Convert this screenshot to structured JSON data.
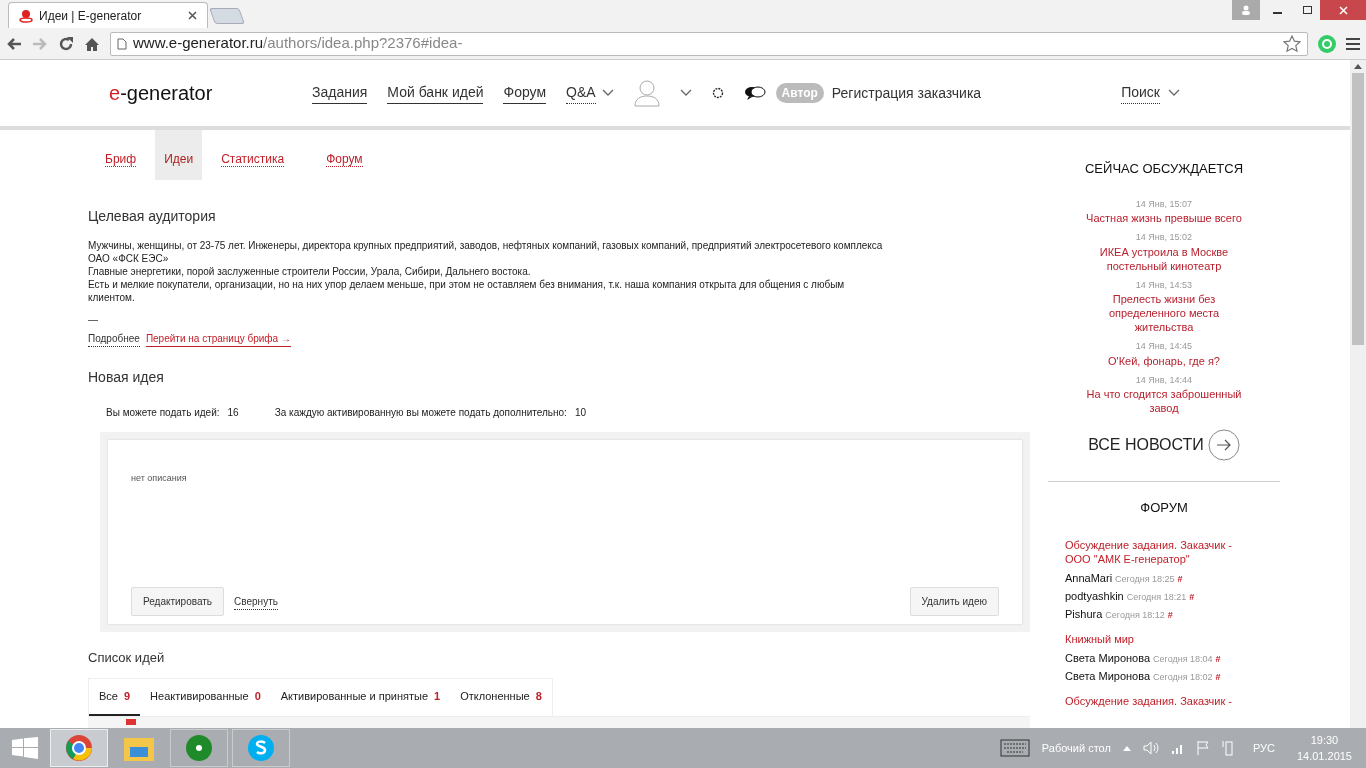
{
  "browser": {
    "tab_title": "Идеи | E-generator",
    "url_domain": "www.e-generator.ru",
    "url_path": "/authors/idea.php?2376#idea-"
  },
  "header": {
    "logo_accent": "e",
    "logo_rest": "-generator",
    "nav": [
      {
        "label": "Задания",
        "dropdown": false
      },
      {
        "label": "Мой банк идей",
        "dropdown": false
      },
      {
        "label": "Форум",
        "dropdown": false
      },
      {
        "label": "Q&A",
        "dropdown": true
      }
    ],
    "badge": "Автор",
    "register": "Регистрация заказчика",
    "search": "Поиск"
  },
  "subtabs": [
    {
      "label": "Бриф",
      "selected": false
    },
    {
      "label": "Идеи",
      "selected": true
    },
    {
      "label": "Статистика",
      "selected": false
    },
    {
      "label": "Форум",
      "selected": false
    }
  ],
  "audience": {
    "title": "Целевая аудитория",
    "lines": [
      "Мужчины, женщины, от 23-75 лет. Инженеры, директора крупных предприятий, заводов, нефтяных компаний, газовых компаний, предприятий электросетевого комплекса ОАО «ФСК ЕЭС»",
      "Главные энергетики, порой заслуженные строители России, Урала, Сибири, Дальнего востока.",
      "Есть и мелкие покупатели, организации, но на них упор делаем меньше, при этом не оставляем без внимания, т.к. наша компания открыта для общения с любым клиентом."
    ],
    "dash": "—",
    "more": "Подробнее",
    "brief_link": "Перейти на страницу брифа →"
  },
  "new_idea": {
    "title": "Новая идея",
    "counts": [
      {
        "label": "Вы можете подать идей:",
        "value": "16"
      },
      {
        "label": "За каждую активированную вы можете подать дополнительно:",
        "value": "10"
      }
    ],
    "description": "нет описания",
    "edit": "Редактировать",
    "collapse": "Свернуть",
    "delete": "Удалить идею"
  },
  "ideas_list": {
    "title": "Список идей",
    "tabs": [
      {
        "label": "Все",
        "count": "9",
        "selected": true
      },
      {
        "label": "Неактивированные",
        "count": "0",
        "selected": false
      },
      {
        "label": "Активированные и принятые",
        "count": "1",
        "selected": false
      },
      {
        "label": "Отклоненные",
        "count": "8",
        "selected": false
      }
    ]
  },
  "discussed": {
    "title": "СЕЙЧАС ОБСУЖДАЕТСЯ",
    "items": [
      {
        "time": "14 Янв, 15:07",
        "title": "Частная жизнь превыше всего"
      },
      {
        "time": "14 Янв, 15:02",
        "title": "ИКЕА устроила в Москве постельный кинотеатр"
      },
      {
        "time": "14 Янв, 14:53",
        "title": "Прелесть жизни без определенного места жительства"
      },
      {
        "time": "14 Янв, 14:45",
        "title": "О'Кей, фонарь, где я?"
      },
      {
        "time": "14 Янв, 14:44",
        "title": "На что сгодится заброшенный завод"
      }
    ],
    "all_news": "ВСЕ НОВОСТИ"
  },
  "forum": {
    "title": "ФОРУМ",
    "topics": [
      {
        "title": "Обсуждение задания. Заказчик - ООО \"АМК Е-генератор\"",
        "posts": [
          {
            "author": "AnnaMari",
            "time": "Сегодня 18:25",
            "mark": "#"
          },
          {
            "author": "podtyashkin",
            "time": "Сегодня 18:21",
            "mark": "#"
          },
          {
            "author": "Pishura",
            "time": "Сегодня 18:12",
            "mark": "#"
          }
        ]
      },
      {
        "title": "Книжный мир",
        "posts": [
          {
            "author": "Света Миронова",
            "time": "Сегодня 18:04",
            "mark": "#"
          },
          {
            "author": "Света Миронова",
            "time": "Сегодня 18:02",
            "mark": "#"
          }
        ]
      },
      {
        "title": "Обсуждение задания. Заказчик -"
      }
    ]
  },
  "taskbar": {
    "desktop": "Рабочий стол",
    "lang": "РУС",
    "time": "19:30",
    "date": "14.01.2015"
  }
}
